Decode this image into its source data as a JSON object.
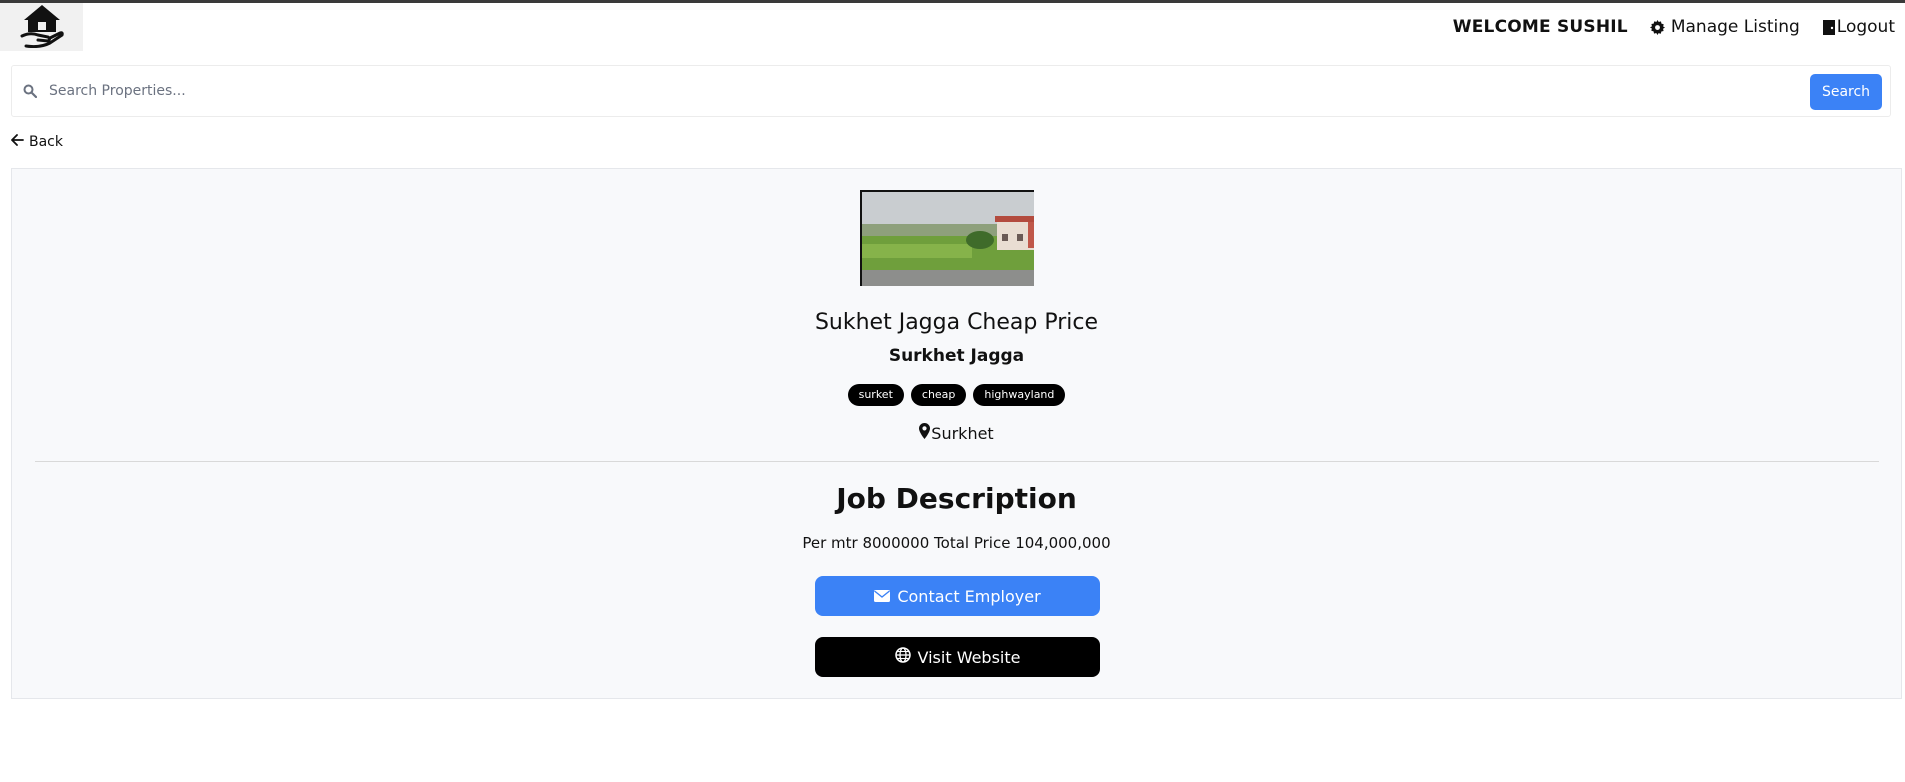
{
  "header": {
    "logo_icon": "house-in-hand-icon",
    "welcome_text": "WELCOME SUSHIL",
    "manage_listing_label": "Manage Listing",
    "manage_listing_icon": "gear-icon",
    "logout_label": "Logout",
    "logout_icon": "door-icon"
  },
  "search": {
    "placeholder": "Search Properties...",
    "value": "",
    "button_label": "Search",
    "icon": "search-icon"
  },
  "back": {
    "label": "Back",
    "icon": "arrow-left-icon"
  },
  "listing": {
    "image_alt": "Land with green field and house",
    "title": "Sukhet Jagga Cheap Price",
    "subtitle": "Surkhet Jagga",
    "tags": [
      "surket",
      "cheap",
      "highwayland"
    ],
    "location": "Surkhet",
    "location_icon": "map-pin-icon",
    "section_title": "Job Description",
    "description": "Per mtr 8000000 Total Price 104,000,000",
    "contact_label": "Contact Employer",
    "contact_icon": "envelope-icon",
    "visit_label": "Visit Website",
    "visit_icon": "globe-icon"
  },
  "colors": {
    "primary": "#3b82f6",
    "dark": "#000000",
    "card_bg": "#f8f9fb"
  }
}
